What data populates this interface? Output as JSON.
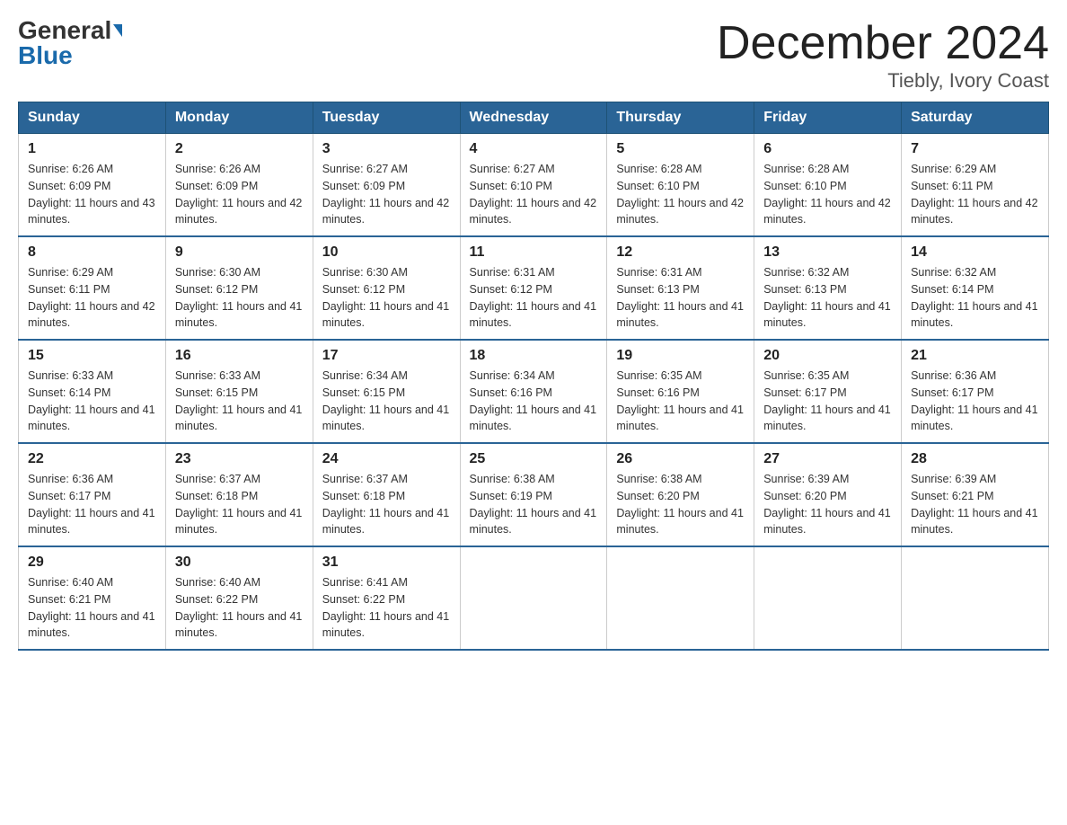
{
  "logo": {
    "general": "General",
    "blue": "Blue"
  },
  "title": {
    "month_year": "December 2024",
    "location": "Tiebly, Ivory Coast"
  },
  "weekdays": [
    "Sunday",
    "Monday",
    "Tuesday",
    "Wednesday",
    "Thursday",
    "Friday",
    "Saturday"
  ],
  "weeks": [
    [
      {
        "day": "1",
        "sunrise": "6:26 AM",
        "sunset": "6:09 PM",
        "daylight": "11 hours and 43 minutes."
      },
      {
        "day": "2",
        "sunrise": "6:26 AM",
        "sunset": "6:09 PM",
        "daylight": "11 hours and 42 minutes."
      },
      {
        "day": "3",
        "sunrise": "6:27 AM",
        "sunset": "6:09 PM",
        "daylight": "11 hours and 42 minutes."
      },
      {
        "day": "4",
        "sunrise": "6:27 AM",
        "sunset": "6:10 PM",
        "daylight": "11 hours and 42 minutes."
      },
      {
        "day": "5",
        "sunrise": "6:28 AM",
        "sunset": "6:10 PM",
        "daylight": "11 hours and 42 minutes."
      },
      {
        "day": "6",
        "sunrise": "6:28 AM",
        "sunset": "6:10 PM",
        "daylight": "11 hours and 42 minutes."
      },
      {
        "day": "7",
        "sunrise": "6:29 AM",
        "sunset": "6:11 PM",
        "daylight": "11 hours and 42 minutes."
      }
    ],
    [
      {
        "day": "8",
        "sunrise": "6:29 AM",
        "sunset": "6:11 PM",
        "daylight": "11 hours and 42 minutes."
      },
      {
        "day": "9",
        "sunrise": "6:30 AM",
        "sunset": "6:12 PM",
        "daylight": "11 hours and 41 minutes."
      },
      {
        "day": "10",
        "sunrise": "6:30 AM",
        "sunset": "6:12 PM",
        "daylight": "11 hours and 41 minutes."
      },
      {
        "day": "11",
        "sunrise": "6:31 AM",
        "sunset": "6:12 PM",
        "daylight": "11 hours and 41 minutes."
      },
      {
        "day": "12",
        "sunrise": "6:31 AM",
        "sunset": "6:13 PM",
        "daylight": "11 hours and 41 minutes."
      },
      {
        "day": "13",
        "sunrise": "6:32 AM",
        "sunset": "6:13 PM",
        "daylight": "11 hours and 41 minutes."
      },
      {
        "day": "14",
        "sunrise": "6:32 AM",
        "sunset": "6:14 PM",
        "daylight": "11 hours and 41 minutes."
      }
    ],
    [
      {
        "day": "15",
        "sunrise": "6:33 AM",
        "sunset": "6:14 PM",
        "daylight": "11 hours and 41 minutes."
      },
      {
        "day": "16",
        "sunrise": "6:33 AM",
        "sunset": "6:15 PM",
        "daylight": "11 hours and 41 minutes."
      },
      {
        "day": "17",
        "sunrise": "6:34 AM",
        "sunset": "6:15 PM",
        "daylight": "11 hours and 41 minutes."
      },
      {
        "day": "18",
        "sunrise": "6:34 AM",
        "sunset": "6:16 PM",
        "daylight": "11 hours and 41 minutes."
      },
      {
        "day": "19",
        "sunrise": "6:35 AM",
        "sunset": "6:16 PM",
        "daylight": "11 hours and 41 minutes."
      },
      {
        "day": "20",
        "sunrise": "6:35 AM",
        "sunset": "6:17 PM",
        "daylight": "11 hours and 41 minutes."
      },
      {
        "day": "21",
        "sunrise": "6:36 AM",
        "sunset": "6:17 PM",
        "daylight": "11 hours and 41 minutes."
      }
    ],
    [
      {
        "day": "22",
        "sunrise": "6:36 AM",
        "sunset": "6:17 PM",
        "daylight": "11 hours and 41 minutes."
      },
      {
        "day": "23",
        "sunrise": "6:37 AM",
        "sunset": "6:18 PM",
        "daylight": "11 hours and 41 minutes."
      },
      {
        "day": "24",
        "sunrise": "6:37 AM",
        "sunset": "6:18 PM",
        "daylight": "11 hours and 41 minutes."
      },
      {
        "day": "25",
        "sunrise": "6:38 AM",
        "sunset": "6:19 PM",
        "daylight": "11 hours and 41 minutes."
      },
      {
        "day": "26",
        "sunrise": "6:38 AM",
        "sunset": "6:20 PM",
        "daylight": "11 hours and 41 minutes."
      },
      {
        "day": "27",
        "sunrise": "6:39 AM",
        "sunset": "6:20 PM",
        "daylight": "11 hours and 41 minutes."
      },
      {
        "day": "28",
        "sunrise": "6:39 AM",
        "sunset": "6:21 PM",
        "daylight": "11 hours and 41 minutes."
      }
    ],
    [
      {
        "day": "29",
        "sunrise": "6:40 AM",
        "sunset": "6:21 PM",
        "daylight": "11 hours and 41 minutes."
      },
      {
        "day": "30",
        "sunrise": "6:40 AM",
        "sunset": "6:22 PM",
        "daylight": "11 hours and 41 minutes."
      },
      {
        "day": "31",
        "sunrise": "6:41 AM",
        "sunset": "6:22 PM",
        "daylight": "11 hours and 41 minutes."
      },
      null,
      null,
      null,
      null
    ]
  ]
}
